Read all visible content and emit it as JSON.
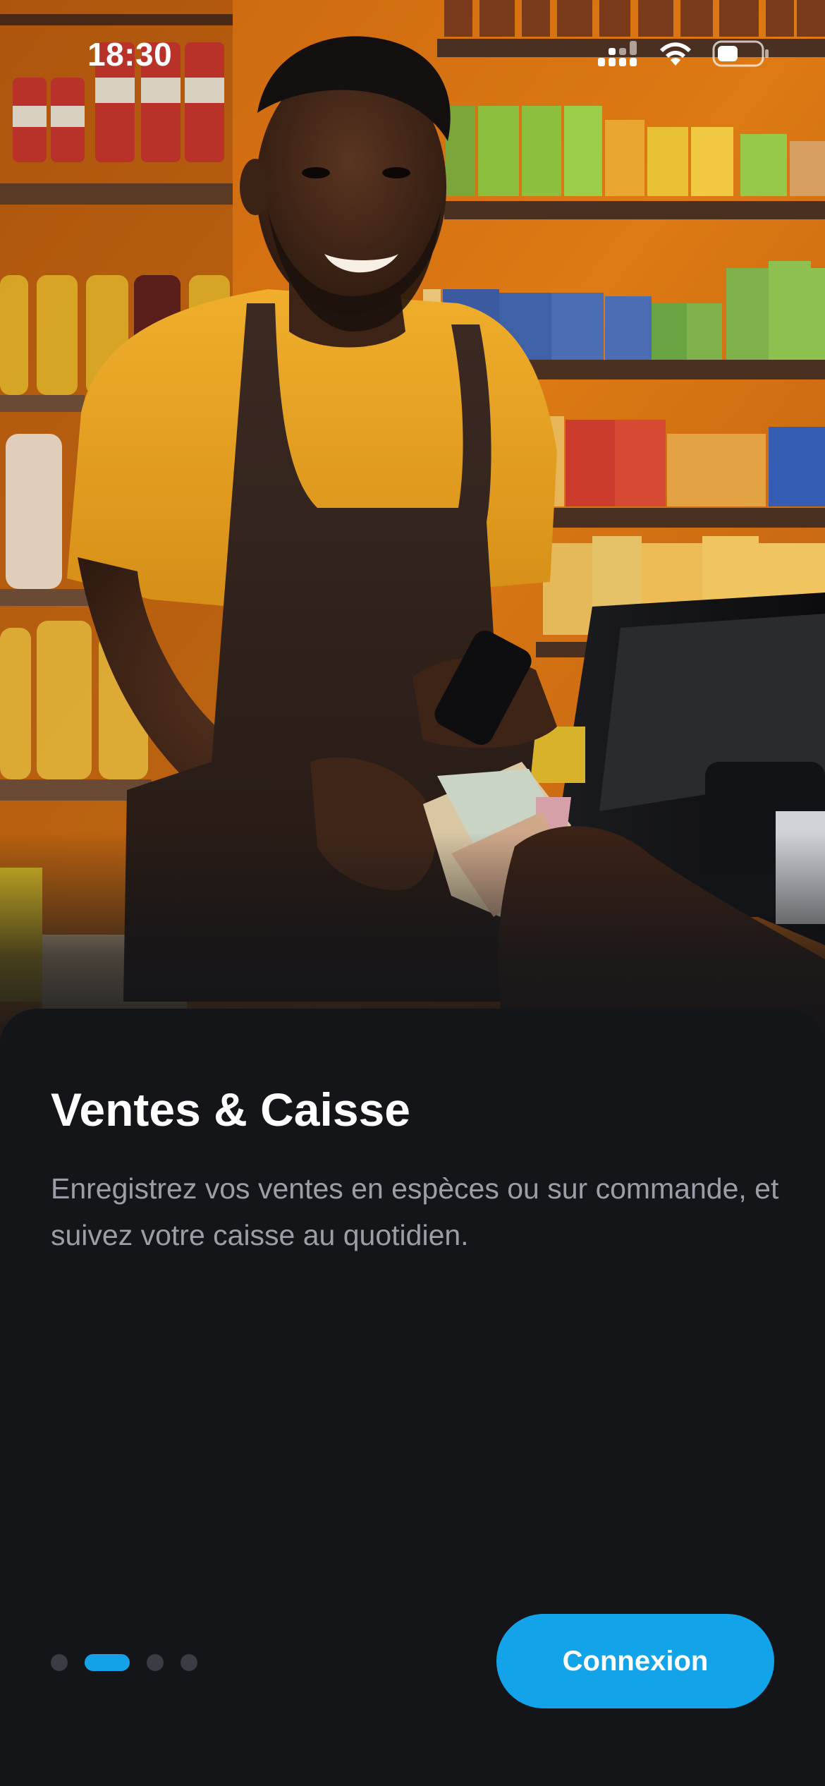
{
  "status_bar": {
    "time": "18:30",
    "icons": [
      "signal-icon",
      "wifi-icon",
      "battery-icon"
    ]
  },
  "hero": {
    "description_icon": "shop-cashier-photo"
  },
  "onboarding": {
    "title": "Ventes & Caisse",
    "description": "Enregistrez vos ventes en espèces ou sur commande, et suivez votre caisse au quotidien.",
    "current_page": 2,
    "total_pages": 4
  },
  "actions": {
    "login_label": "Connexion"
  },
  "colors": {
    "background": "#141519",
    "accent": "#12A3E9",
    "title": "#FFFFFF",
    "description": "#9B9EA6",
    "dot_inactive": "#3B3D44"
  }
}
